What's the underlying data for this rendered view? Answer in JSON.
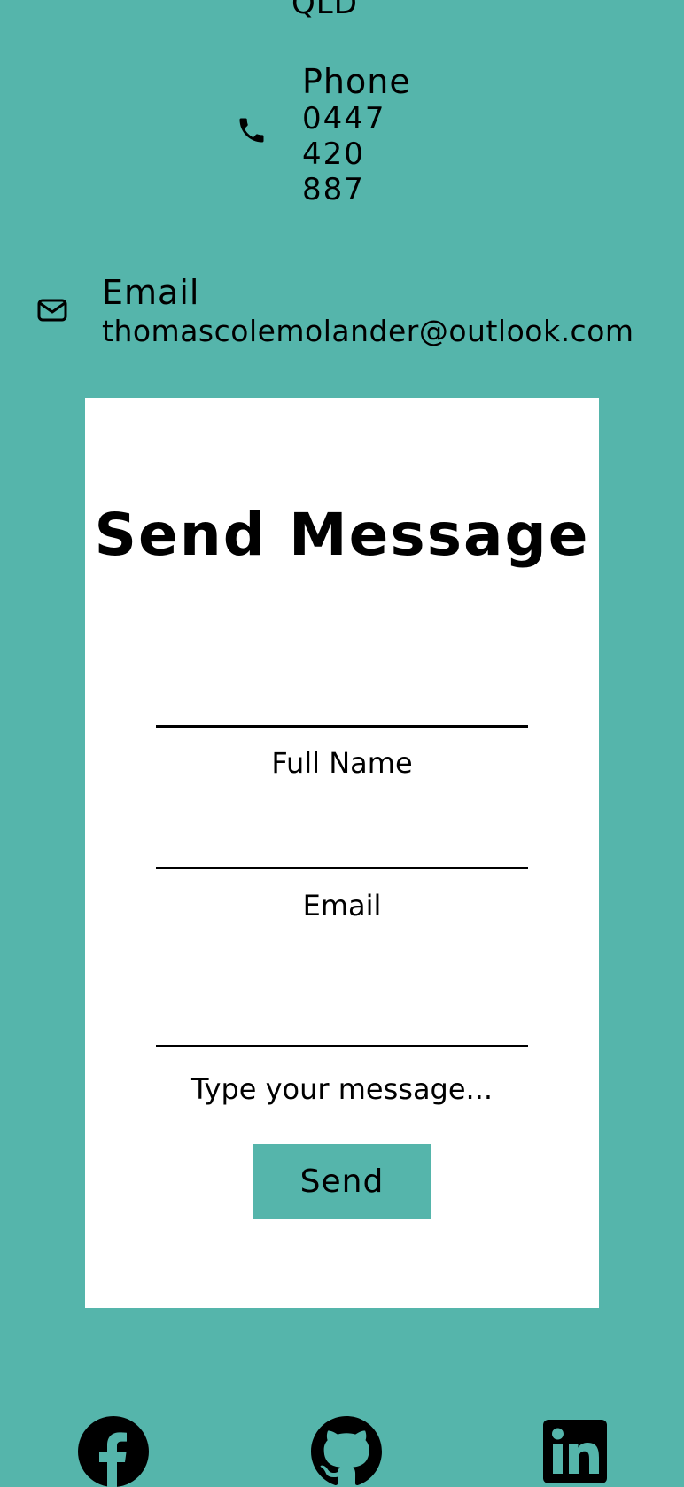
{
  "contact": {
    "location": "QLD",
    "phone": {
      "heading": "Phone",
      "line1": "0447",
      "line2": "420",
      "line3": "887"
    },
    "email": {
      "heading": "Email",
      "address": "thomascolemolander@outlook.com"
    }
  },
  "form": {
    "title": "Send Message",
    "name_label": "Full Name",
    "email_label": "Email",
    "message_label": "Type your message...",
    "send_label": "Send"
  },
  "social": {
    "icons": [
      "facebook-icon",
      "github-icon",
      "linkedin-icon"
    ]
  },
  "colors": {
    "background": "#55b5ab",
    "card": "#ffffff",
    "text": "#000000",
    "button": "#55b5ab"
  }
}
